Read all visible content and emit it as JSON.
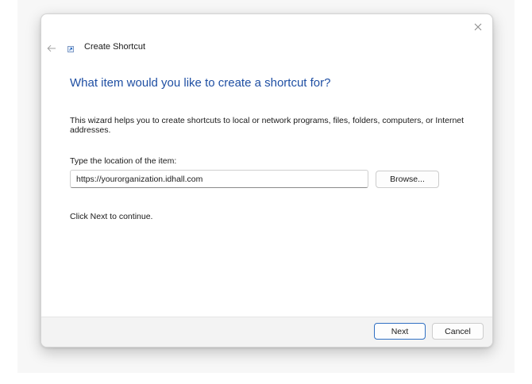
{
  "dialog": {
    "title": "Create Shortcut",
    "heading": "What item would you like to create a shortcut for?",
    "description": "This wizard helps you to create shortcuts to local or network programs, files, folders, computers, or Internet addresses.",
    "location_label": "Type the location of the item:",
    "location_value": "https://yourorganization.idhall.com",
    "browse_label": "Browse...",
    "continue_text": "Click Next to continue."
  },
  "footer": {
    "next_label": "Next",
    "cancel_label": "Cancel"
  },
  "icons": {
    "close": "close-icon",
    "back": "back-arrow-icon",
    "title": "shortcut-icon"
  },
  "colors": {
    "heading": "#1f4fa3",
    "default_button_border": "#2f6fc2",
    "footer_background": "#f3f3f3"
  }
}
